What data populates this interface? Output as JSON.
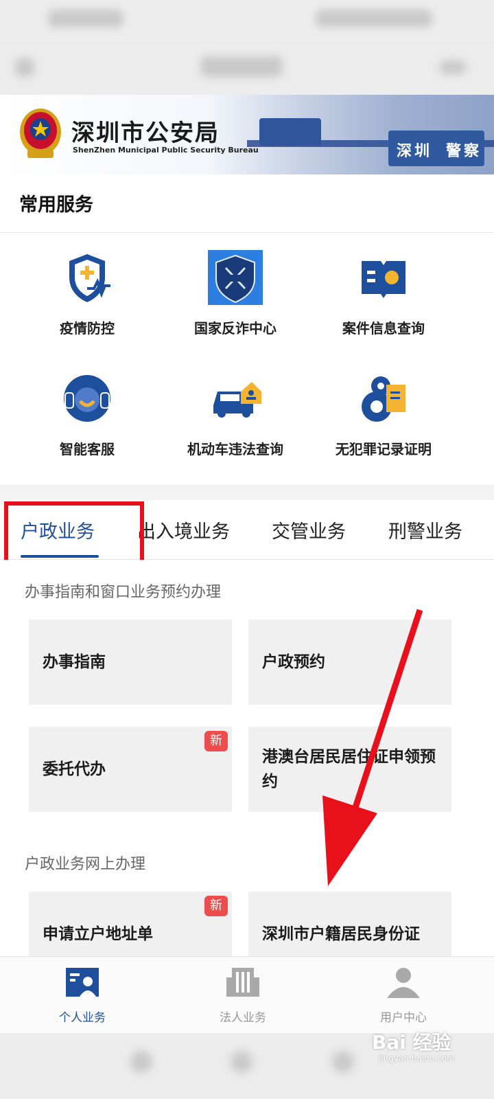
{
  "banner": {
    "title_cn": "深圳市公安局",
    "title_en": "ShenZhen Municipal Public Security Bureau",
    "sign1": "深圳",
    "sign2": "警察"
  },
  "common": {
    "title": "常用服务",
    "items": [
      {
        "label": "疫情防控",
        "icon": "shield-health-icon"
      },
      {
        "label": "国家反诈中心",
        "icon": "anti-fraud-badge-icon",
        "icon_text": "国家反诈中心"
      },
      {
        "label": "案件信息查询",
        "icon": "case-search-icon"
      },
      {
        "label": "智能客服",
        "icon": "smart-service-icon"
      },
      {
        "label": "机动车违法查询",
        "icon": "car-violation-icon"
      },
      {
        "label": "无犯罪记录证明",
        "icon": "no-crime-certificate-icon"
      }
    ]
  },
  "tabs": [
    {
      "label": "户政业务",
      "active": true
    },
    {
      "label": "出入境业务",
      "active": false
    },
    {
      "label": "交管业务",
      "active": false
    },
    {
      "label": "刑警业务",
      "active": false
    }
  ],
  "section1": {
    "heading": "办事指南和窗口业务预约办理",
    "cards": [
      {
        "title": "办事指南",
        "badge": ""
      },
      {
        "title": "户政预约",
        "badge": ""
      },
      {
        "title": "委托代办",
        "badge": "新"
      },
      {
        "title": "港澳台居民居住证申领预约",
        "badge": ""
      }
    ]
  },
  "section2": {
    "heading": "户政业务网上办理",
    "cards": [
      {
        "title": "申请立户地址单",
        "badge": "新"
      },
      {
        "title": "深圳市户籍居民身份证",
        "badge": ""
      }
    ]
  },
  "bottom_nav": [
    {
      "label": "个人业务",
      "icon": "personal-icon",
      "active": true
    },
    {
      "label": "法人业务",
      "icon": "building-icon",
      "active": false
    },
    {
      "label": "用户中心",
      "icon": "user-icon",
      "active": false
    }
  ],
  "watermark": {
    "text": "Bai 经验",
    "sub": "jingyan.baidu.com"
  },
  "colors": {
    "primary": "#1e4f9c",
    "annotation": "#e8111b",
    "badge": "#ee4d4d"
  }
}
